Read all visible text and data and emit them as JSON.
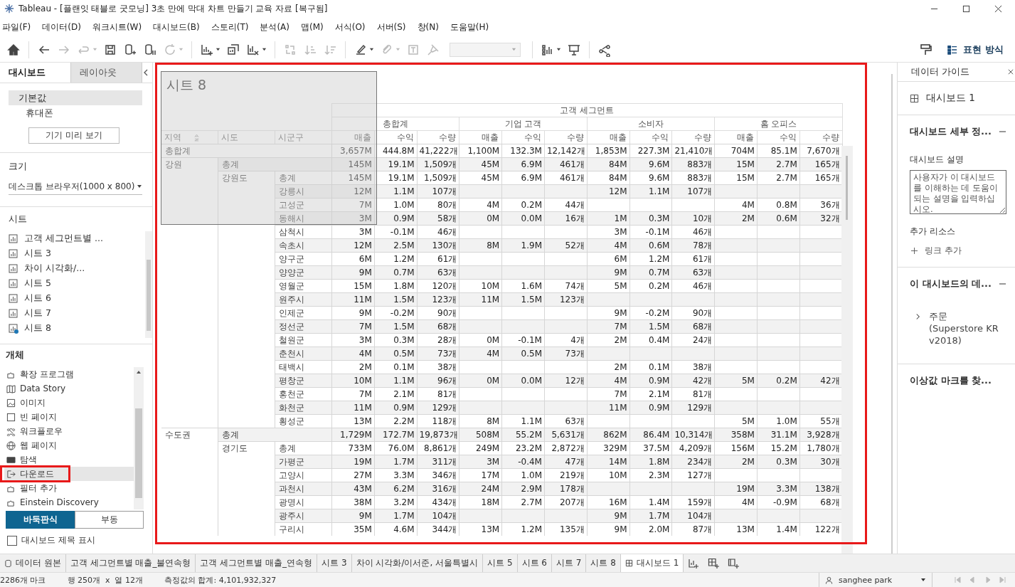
{
  "window": {
    "title": "Tableau - [플랜잇 태블로 굿모닝] 3초 만에 막대 차트 만들기 교육 자료 [복구됨]"
  },
  "menu": [
    "파일(F)",
    "데이터(D)",
    "워크시트(W)",
    "대시보드(B)",
    "스토리(T)",
    "분석(A)",
    "맵(M)",
    "서식(O)",
    "서버(S)",
    "창(N)",
    "도움말(H)"
  ],
  "toolbar": [
    {
      "kind": "button",
      "disabled": false,
      "caret": false
    },
    {
      "kind": "button",
      "disabled": false,
      "caret": false
    },
    {
      "kind": "button",
      "disabled": true,
      "caret": false
    },
    {
      "kind": "button",
      "disabled": true,
      "caret": true
    },
    {
      "kind": "button",
      "disabled": false,
      "caret": false
    },
    {
      "kind": "button",
      "disabled": false,
      "caret": false
    },
    {
      "kind": "button",
      "disabled": false,
      "caret": false
    },
    {
      "kind": "button",
      "disabled": true,
      "caret": true
    },
    {
      "kind": "button",
      "disabled": false,
      "caret": true
    },
    {
      "kind": "button",
      "disabled": false,
      "caret": false
    },
    {
      "kind": "button",
      "disabled": false,
      "caret": true
    },
    {
      "kind": "button",
      "disabled": true,
      "caret": false
    },
    {
      "kind": "button",
      "disabled": true,
      "caret": false
    },
    {
      "kind": "button",
      "disabled": true,
      "caret": false
    },
    {
      "kind": "button",
      "disabled": false,
      "caret": true
    },
    {
      "kind": "button",
      "disabled": true,
      "caret": true
    },
    {
      "kind": "button",
      "disabled": true,
      "caret": false
    },
    {
      "kind": "button",
      "disabled": true,
      "caret": false
    },
    {
      "kind": "dropdown",
      "disabled": true,
      "caret": true
    },
    {
      "kind": "button",
      "disabled": false,
      "caret": true
    },
    {
      "kind": "button",
      "disabled": false,
      "caret": false
    },
    {
      "kind": "button",
      "disabled": false,
      "caret": false
    }
  ],
  "presentation_button": "표현 방식",
  "left_panel": {
    "tabs": [
      {
        "label": "대시보드",
        "selected": true
      },
      {
        "label": "레이아웃",
        "selected": false
      }
    ],
    "devices": [
      {
        "label": "기본값",
        "selected": true
      },
      {
        "label": "휴대폰",
        "selected": false
      }
    ],
    "preview_button": "기기 미리 보기",
    "size": {
      "title": "크기",
      "value": "데스크톱 브라우저(1000 x 800)"
    },
    "sheets": {
      "title": "시트",
      "items": [
        {
          "label": "고객 세그먼트별 ...",
          "used": false
        },
        {
          "label": "시트 3",
          "used": false
        },
        {
          "label": "차이 시각화/...",
          "used": false
        },
        {
          "label": "시트 5",
          "used": false
        },
        {
          "label": "시트 6",
          "used": false
        },
        {
          "label": "시트 7",
          "used": false
        },
        {
          "label": "시트 8",
          "used": true
        }
      ]
    },
    "objects": {
      "title": "개체",
      "items": [
        {
          "label": "확장 프로그램",
          "kind": "extension",
          "selected": false,
          "highlighted": false
        },
        {
          "label": "Data Story",
          "kind": "story",
          "selected": false,
          "highlighted": false
        },
        {
          "label": "이미지",
          "kind": "image",
          "selected": false,
          "highlighted": false
        },
        {
          "label": "빈 페이지",
          "kind": "blank",
          "selected": false,
          "highlighted": false
        },
        {
          "label": "워크플로우",
          "kind": "workflow",
          "selected": false,
          "highlighted": false
        },
        {
          "label": "웹 페이지",
          "kind": "web",
          "selected": false,
          "highlighted": false
        },
        {
          "label": "탐색",
          "kind": "navigation",
          "selected": false,
          "highlighted": false
        },
        {
          "label": "다운로드",
          "kind": "download",
          "selected": true,
          "highlighted": true
        },
        {
          "label": "필터 추가",
          "kind": "extension",
          "selected": false,
          "highlighted": false
        },
        {
          "label": "Einstein Discovery",
          "kind": "extension",
          "selected": false,
          "highlighted": false
        }
      ]
    },
    "layout_modes": [
      {
        "label": "바둑판식",
        "selected": true
      },
      {
        "label": "부동",
        "selected": false
      }
    ],
    "show_title": {
      "label": "대시보드 제목 표시",
      "checked": false
    }
  },
  "sheet_overlay": {
    "title": "시트 8"
  },
  "table": {
    "super_header": "고객 세그먼트",
    "row_headers": [
      "지역",
      "시도",
      "시군구"
    ],
    "column_groups": [
      {
        "label": "총합계",
        "measures": [
          "매출",
          "수익",
          "수량"
        ]
      },
      {
        "label": "기업 고객",
        "measures": [
          "매출",
          "수익",
          "수량"
        ]
      },
      {
        "label": "소비자",
        "measures": [
          "매출",
          "수익",
          "수량"
        ]
      },
      {
        "label": "홈 오피스",
        "measures": [
          "매출",
          "수익",
          "수량"
        ]
      }
    ],
    "rows": [
      {
        "kind": "grand_total",
        "label": "총합계",
        "total": {
          "sales": "3,657M",
          "profit": "444.8M",
          "quantity": "41,222개"
        },
        "corporate": {
          "sales": "1,100M",
          "profit": "132.3M",
          "quantity": "12,142개"
        },
        "consumer": {
          "sales": "1,853M",
          "profit": "227.3M",
          "quantity": "21,410개"
        },
        "home_office": {
          "sales": "704M",
          "profit": "85.1M",
          "quantity": "7,670개"
        }
      },
      {
        "kind": "region_total",
        "region": "강원",
        "label": "총계",
        "total": {
          "sales": "145M",
          "profit": "19.1M",
          "quantity": "1,509개"
        },
        "corporate": {
          "sales": "45M",
          "profit": "6.9M",
          "quantity": "461개"
        },
        "consumer": {
          "sales": "84M",
          "profit": "9.6M",
          "quantity": "883개"
        },
        "home_office": {
          "sales": "15M",
          "profit": "2.7M",
          "quantity": "165개"
        }
      },
      {
        "kind": "province_total",
        "province": "강원도",
        "label": "총계",
        "total": {
          "sales": "145M",
          "profit": "19.1M",
          "quantity": "1,509개"
        },
        "corporate": {
          "sales": "45M",
          "profit": "6.9M",
          "quantity": "461개"
        },
        "consumer": {
          "sales": "84M",
          "profit": "9.6M",
          "quantity": "883개"
        },
        "home_office": {
          "sales": "15M",
          "profit": "2.7M",
          "quantity": "165개"
        }
      },
      {
        "kind": "city",
        "label": "강릉시",
        "total": {
          "sales": "12M",
          "profit": "1.1M",
          "quantity": "107개"
        },
        "consumer": {
          "sales": "12M",
          "profit": "1.1M",
          "quantity": "107개"
        }
      },
      {
        "kind": "city",
        "label": "고성군",
        "total": {
          "sales": "7M",
          "profit": "1.0M",
          "quantity": "80개"
        },
        "corporate": {
          "sales": "4M",
          "profit": "0.2M",
          "quantity": "44개"
        },
        "home_office": {
          "sales": "4M",
          "profit": "0.8M",
          "quantity": "36개"
        }
      },
      {
        "kind": "city",
        "label": "동해시",
        "total": {
          "sales": "3M",
          "profit": "0.9M",
          "quantity": "58개"
        },
        "corporate": {
          "sales": "0M",
          "profit": "0.0M",
          "quantity": "16개"
        },
        "consumer": {
          "sales": "1M",
          "profit": "0.3M",
          "quantity": "10개"
        },
        "home_office": {
          "sales": "2M",
          "profit": "0.6M",
          "quantity": "32개"
        }
      },
      {
        "kind": "city",
        "label": "삼척시",
        "total": {
          "sales": "3M",
          "profit": "-0.1M",
          "quantity": "46개"
        },
        "consumer": {
          "sales": "3M",
          "profit": "-0.1M",
          "quantity": "46개"
        }
      },
      {
        "kind": "city",
        "label": "속초시",
        "total": {
          "sales": "12M",
          "profit": "2.5M",
          "quantity": "130개"
        },
        "corporate": {
          "sales": "8M",
          "profit": "1.9M",
          "quantity": "52개"
        },
        "consumer": {
          "sales": "4M",
          "profit": "0.6M",
          "quantity": "78개"
        }
      },
      {
        "kind": "city",
        "label": "양구군",
        "total": {
          "sales": "6M",
          "profit": "1.2M",
          "quantity": "61개"
        },
        "consumer": {
          "sales": "6M",
          "profit": "1.2M",
          "quantity": "61개"
        }
      },
      {
        "kind": "city",
        "label": "양양군",
        "total": {
          "sales": "9M",
          "profit": "0.7M",
          "quantity": "63개"
        },
        "consumer": {
          "sales": "9M",
          "profit": "0.7M",
          "quantity": "63개"
        }
      },
      {
        "kind": "city",
        "label": "영월군",
        "total": {
          "sales": "15M",
          "profit": "1.8M",
          "quantity": "120개"
        },
        "corporate": {
          "sales": "10M",
          "profit": "1.6M",
          "quantity": "74개"
        },
        "consumer": {
          "sales": "5M",
          "profit": "0.2M",
          "quantity": "46개"
        }
      },
      {
        "kind": "city",
        "label": "원주시",
        "total": {
          "sales": "11M",
          "profit": "1.5M",
          "quantity": "123개"
        },
        "corporate": {
          "sales": "11M",
          "profit": "1.5M",
          "quantity": "123개"
        }
      },
      {
        "kind": "city",
        "label": "인제군",
        "total": {
          "sales": "9M",
          "profit": "-0.2M",
          "quantity": "90개"
        },
        "consumer": {
          "sales": "9M",
          "profit": "-0.2M",
          "quantity": "90개"
        }
      },
      {
        "kind": "city",
        "label": "정선군",
        "total": {
          "sales": "7M",
          "profit": "1.5M",
          "quantity": "68개"
        },
        "consumer": {
          "sales": "7M",
          "profit": "1.5M",
          "quantity": "68개"
        }
      },
      {
        "kind": "city",
        "label": "철원군",
        "total": {
          "sales": "3M",
          "profit": "0.3M",
          "quantity": "28개"
        },
        "corporate": {
          "sales": "0M",
          "profit": "-0.1M",
          "quantity": "4개"
        },
        "consumer": {
          "sales": "2M",
          "profit": "0.4M",
          "quantity": "24개"
        }
      },
      {
        "kind": "city",
        "label": "춘천시",
        "total": {
          "sales": "4M",
          "profit": "0.5M",
          "quantity": "73개"
        },
        "corporate": {
          "sales": "4M",
          "profit": "0.5M",
          "quantity": "73개"
        }
      },
      {
        "kind": "city",
        "label": "태백시",
        "total": {
          "sales": "2M",
          "profit": "0.1M",
          "quantity": "38개"
        },
        "consumer": {
          "sales": "2M",
          "profit": "0.1M",
          "quantity": "38개"
        }
      },
      {
        "kind": "city",
        "label": "평창군",
        "total": {
          "sales": "10M",
          "profit": "1.1M",
          "quantity": "96개"
        },
        "corporate": {
          "sales": "0M",
          "profit": "0.0M",
          "quantity": "12개"
        },
        "consumer": {
          "sales": "4M",
          "profit": "0.9M",
          "quantity": "42개"
        },
        "home_office": {
          "sales": "5M",
          "profit": "0.2M",
          "quantity": "42개"
        }
      },
      {
        "kind": "city",
        "label": "홍천군",
        "total": {
          "sales": "7M",
          "profit": "2.1M",
          "quantity": "81개"
        },
        "consumer": {
          "sales": "7M",
          "profit": "2.1M",
          "quantity": "81개"
        }
      },
      {
        "kind": "city",
        "label": "화천군",
        "total": {
          "sales": "11M",
          "profit": "0.9M",
          "quantity": "129개"
        },
        "consumer": {
          "sales": "11M",
          "profit": "0.9M",
          "quantity": "129개"
        }
      },
      {
        "kind": "city",
        "label": "횡성군",
        "total": {
          "sales": "13M",
          "profit": "2.2M",
          "quantity": "118개"
        },
        "corporate": {
          "sales": "8M",
          "profit": "1.1M",
          "quantity": "63개"
        },
        "home_office": {
          "sales": "5M",
          "profit": "1.0M",
          "quantity": "55개"
        }
      },
      {
        "kind": "region_total",
        "region": "수도권",
        "label": "총계",
        "total": {
          "sales": "1,729M",
          "profit": "172.7M",
          "quantity": "19,873개"
        },
        "corporate": {
          "sales": "508M",
          "profit": "55.2M",
          "quantity": "5,631개"
        },
        "consumer": {
          "sales": "862M",
          "profit": "86.4M",
          "quantity": "10,314개"
        },
        "home_office": {
          "sales": "358M",
          "profit": "31.1M",
          "quantity": "3,928개"
        }
      },
      {
        "kind": "province_total",
        "province": "경기도",
        "label": "총계",
        "total": {
          "sales": "733M",
          "profit": "76.0M",
          "quantity": "8,861개"
        },
        "corporate": {
          "sales": "249M",
          "profit": "23.2M",
          "quantity": "2,872개"
        },
        "consumer": {
          "sales": "329M",
          "profit": "37.5M",
          "quantity": "4,209개"
        },
        "home_office": {
          "sales": "156M",
          "profit": "15.2M",
          "quantity": "1,780개"
        }
      },
      {
        "kind": "city",
        "label": "가평군",
        "total": {
          "sales": "19M",
          "profit": "1.7M",
          "quantity": "311개"
        },
        "corporate": {
          "sales": "3M",
          "profit": "-0.4M",
          "quantity": "47개"
        },
        "consumer": {
          "sales": "14M",
          "profit": "1.8M",
          "quantity": "234개"
        },
        "home_office": {
          "sales": "2M",
          "profit": "0.3M",
          "quantity": "30개"
        }
      },
      {
        "kind": "city",
        "label": "고양시",
        "total": {
          "sales": "27M",
          "profit": "3.3M",
          "quantity": "346개"
        },
        "corporate": {
          "sales": "17M",
          "profit": "1.0M",
          "quantity": "219개"
        },
        "consumer": {
          "sales": "10M",
          "profit": "2.3M",
          "quantity": "127개"
        }
      },
      {
        "kind": "city",
        "label": "과천시",
        "total": {
          "sales": "43M",
          "profit": "6.2M",
          "quantity": "316개"
        },
        "corporate": {
          "sales": "24M",
          "profit": "2.9M",
          "quantity": "178개"
        },
        "home_office": {
          "sales": "19M",
          "profit": "3.3M",
          "quantity": "138개"
        }
      },
      {
        "kind": "city",
        "label": "광명시",
        "total": {
          "sales": "38M",
          "profit": "3.2M",
          "quantity": "434개"
        },
        "corporate": {
          "sales": "18M",
          "profit": "2.7M",
          "quantity": "207개"
        },
        "consumer": {
          "sales": "16M",
          "profit": "1.4M",
          "quantity": "159개"
        },
        "home_office": {
          "sales": "4M",
          "profit": "-0.9M",
          "quantity": "68개"
        }
      },
      {
        "kind": "city",
        "label": "광주시",
        "total": {
          "sales": "9M",
          "profit": "1.7M",
          "quantity": "104개"
        },
        "consumer": {
          "sales": "9M",
          "profit": "1.7M",
          "quantity": "104개"
        }
      },
      {
        "kind": "city",
        "label": "구리시",
        "total": {
          "sales": "35M",
          "profit": "4.6M",
          "quantity": "344개"
        },
        "corporate": {
          "sales": "13M",
          "profit": "1.2M",
          "quantity": "135개"
        },
        "consumer": {
          "sales": "9M",
          "profit": "2.0M",
          "quantity": "87개"
        },
        "home_office": {
          "sales": "13M",
          "profit": "1.4M",
          "quantity": "122개"
        }
      }
    ]
  },
  "right_panel": {
    "title": "데이터 가이드",
    "dashboard": "대시보드 1",
    "details_title": "대시보드 세부 정...",
    "description_label": "대시보드 설명",
    "description_placeholder": "사용자가 이 대시보드를 이해하는 데 도움이 되는 설명을 입력하십시오.",
    "resources_label": "추가 리소스",
    "add_link": "링크 추가",
    "data_title": "이 대시보드의 데...",
    "data_source": "주문 (Superstore KR v2018)",
    "outliers_title": "이상값 마크를 찾..."
  },
  "sheet_tabs": [
    {
      "label": "데이터 원본",
      "kind": "data_source",
      "selected": false
    },
    {
      "label": "고객 세그먼트별 매출_불연속형",
      "kind": "sheet",
      "selected": false
    },
    {
      "label": "고객 세그먼트별 매출_연속형",
      "kind": "sheet",
      "selected": false
    },
    {
      "label": "시트 3",
      "kind": "sheet",
      "selected": false
    },
    {
      "label": "차이 시각화/이서준, 서울특별시",
      "kind": "sheet",
      "selected": false
    },
    {
      "label": "시트 5",
      "kind": "sheet",
      "selected": false
    },
    {
      "label": "시트 6",
      "kind": "sheet",
      "selected": false
    },
    {
      "label": "시트 7",
      "kind": "sheet",
      "selected": false
    },
    {
      "label": "시트 8",
      "kind": "sheet",
      "selected": false
    },
    {
      "label": "대시보드 1",
      "kind": "dashboard",
      "selected": true
    }
  ],
  "status_bar": {
    "marks": "2286개 마크",
    "rows_cols": "행 250개  x  열 12개",
    "sum": "측정값의 합계: 4,101,932,327",
    "user": "sanghee park"
  }
}
